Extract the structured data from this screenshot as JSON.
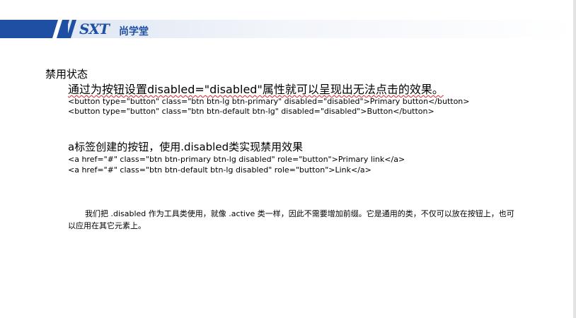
{
  "brand": {
    "logo_text": "SXT",
    "logo_cn": "尚学堂"
  },
  "content": {
    "heading": "禁用状态",
    "button_section": {
      "intro": "通过为按钮设置disabled=\"disabled\"属性就可以呈现出无法点击的效果。",
      "code_lines": [
        "<button type=\"button\" class=\"btn btn-lg btn-primary\" disabled=\"disabled\">Primary  button</button>",
        "<button type=\"button\" class=\"btn btn-default btn-lg\" disabled=\"disabled\">Button</button>"
      ]
    },
    "link_section": {
      "intro": "a标签创建的按钮，使用.disabled类实现禁用效果",
      "code_lines": [
        "<a href=\"#\" class=\"btn btn-primary btn-lg disabled\"  role=\"button\">Primary link</a>",
        "<a href=\"#\" class=\"btn btn-default btn-lg disabled\"  role=\"button\">Link</a>"
      ]
    },
    "note": "我们把 .disabled 作为工具类使用，就像 .active 类一样，因此不需要增加前缀。它是通用的类，不仅可以放在按钮上，也可以应用在其它元素上。"
  },
  "colors": {
    "brand_blue": "#1e4fa3",
    "spellcheck_red": "#d22"
  }
}
